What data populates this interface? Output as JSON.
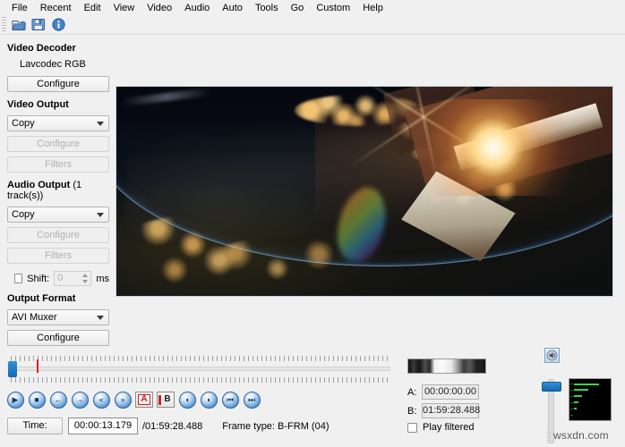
{
  "menubar": {
    "items": [
      {
        "label": "File"
      },
      {
        "label": "Recent"
      },
      {
        "label": "Edit"
      },
      {
        "label": "View"
      },
      {
        "label": "Video"
      },
      {
        "label": "Audio"
      },
      {
        "label": "Auto"
      },
      {
        "label": "Tools"
      },
      {
        "label": "Go"
      },
      {
        "label": "Custom"
      },
      {
        "label": "Help"
      }
    ]
  },
  "toolbar": {
    "buttons": [
      {
        "name": "open-file-icon",
        "glyph": "📂"
      },
      {
        "name": "save-file-icon",
        "glyph": "💾"
      },
      {
        "name": "info-icon",
        "glyph": "ℹ"
      }
    ]
  },
  "left_panel": {
    "video_decoder": {
      "title": "Video Decoder",
      "codec": "Lavcodec",
      "colorspace": "RGB",
      "configure_label": "Configure"
    },
    "video_output": {
      "title": "Video Output",
      "selected": "Copy",
      "configure_label": "Configure",
      "filters_label": "Filters"
    },
    "audio_output": {
      "title": "Audio Output",
      "title_suffix": "(1 track(s))",
      "selected": "Copy",
      "configure_label": "Configure",
      "filters_label": "Filters",
      "shift_label": "Shift:",
      "shift_value": "0",
      "shift_unit": "ms"
    },
    "output_format": {
      "title": "Output Format",
      "selected": "AVI Muxer",
      "configure_label": "Configure"
    }
  },
  "transport": {
    "buttons": [
      {
        "name": "play-button",
        "glyph": "▶"
      },
      {
        "name": "stop-button",
        "glyph": "■"
      },
      {
        "name": "previous-frame-button",
        "glyph": "←"
      },
      {
        "name": "next-frame-button",
        "glyph": "→"
      },
      {
        "name": "rewind-button",
        "glyph": "«"
      },
      {
        "name": "fast-forward-button",
        "glyph": "»"
      },
      {
        "name": "mark-a-button",
        "glyph": "A"
      },
      {
        "name": "mark-b-button",
        "glyph": "B"
      },
      {
        "name": "previous-keyframe-button",
        "glyph": "◖"
      },
      {
        "name": "next-keyframe-button",
        "glyph": "◗"
      },
      {
        "name": "go-to-start-button",
        "glyph": "⏮"
      },
      {
        "name": "go-to-end-button",
        "glyph": "⏭"
      }
    ]
  },
  "status": {
    "time_label": "Time:",
    "current_time": "00:00:13.179",
    "total_time": "/01:59:28.488",
    "frame_type_label": "Frame type:",
    "frame_type_value": "B-FRM (04)"
  },
  "markers": {
    "a_label": "A:",
    "a_value": "00:00:00.00",
    "b_label": "B:",
    "b_value": "01:59:28.488",
    "play_filtered_label": "Play filtered"
  },
  "audio": {
    "volume_icon": "speaker-icon",
    "meter_levels": [
      28,
      16,
      9,
      5,
      3
    ]
  },
  "watermark": {
    "text": "wsxdn.com"
  },
  "colors": {
    "accent": "#1767b0",
    "window_bg": "#f0f0f0",
    "marker_red": "#e02020",
    "meter_green": "#3bd63b"
  }
}
